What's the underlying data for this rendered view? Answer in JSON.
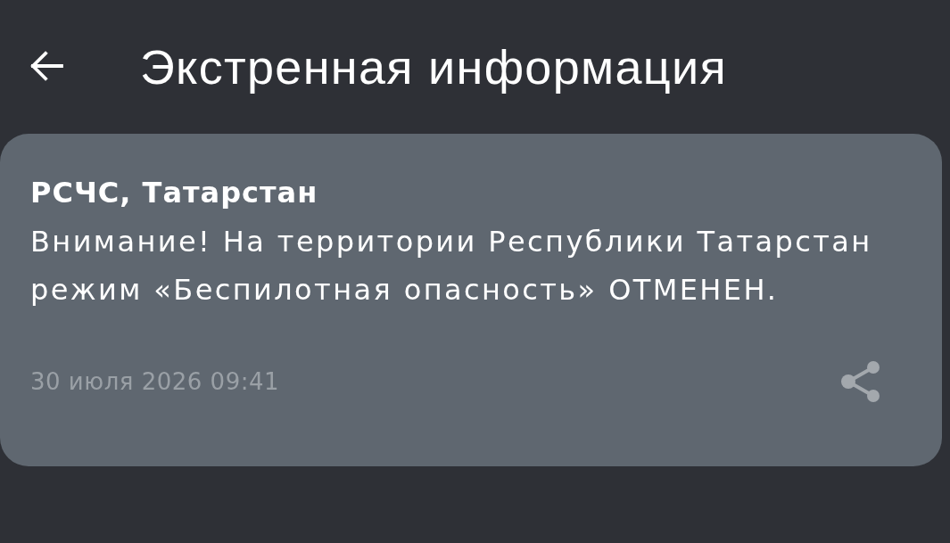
{
  "header": {
    "title": "Экстренная информация"
  },
  "alerts": [
    {
      "source": "РСЧС, Татарстан",
      "message": "Внимание! На территории Республики Татарстан режим «Беспилотная опасность» ОТМЕНЕН.",
      "timestamp": "30 июля 2026 09:41"
    }
  ]
}
